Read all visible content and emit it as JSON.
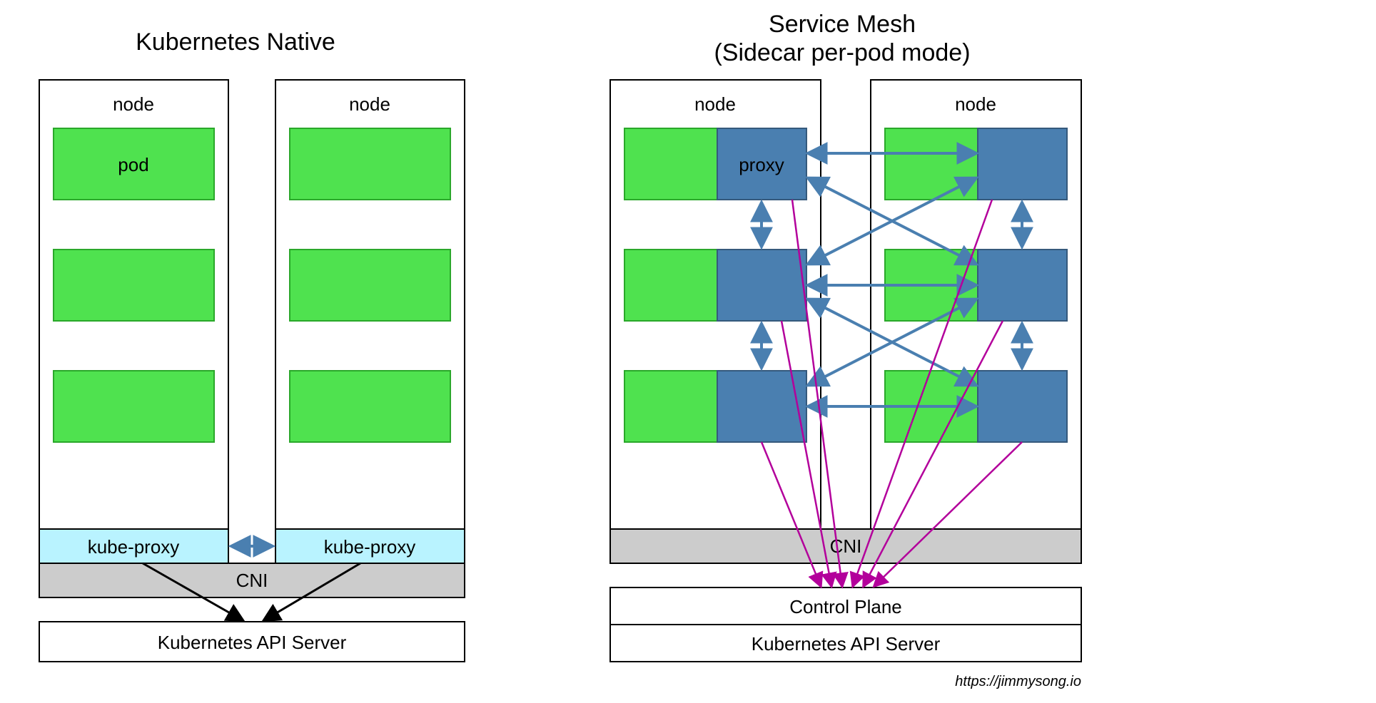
{
  "left": {
    "title": "Kubernetes Native",
    "node_label": "node",
    "pod_label": "pod",
    "kubeproxy_label": "kube-proxy",
    "cni_label": "CNI",
    "api_label": "Kubernetes API Server"
  },
  "right": {
    "title_line1": "Service Mesh",
    "title_line2": "(Sidecar per-pod mode)",
    "node_label": "node",
    "proxy_label": "proxy",
    "cni_label": "CNI",
    "control_plane_label": "Control Plane",
    "api_label": "Kubernetes API Server"
  },
  "source_url": "https://jimmysong.io",
  "colors": {
    "pod_fill": "#4fe24f",
    "pod_stroke": "#2aa82a",
    "proxy_fill": "#4a7fb0",
    "kubeproxy_fill": "#b9f3ff",
    "cni_fill": "#cccccc",
    "box_stroke": "#000000",
    "blue_arrow": "#4a7fb0",
    "magenta_arrow": "#b3009b"
  }
}
